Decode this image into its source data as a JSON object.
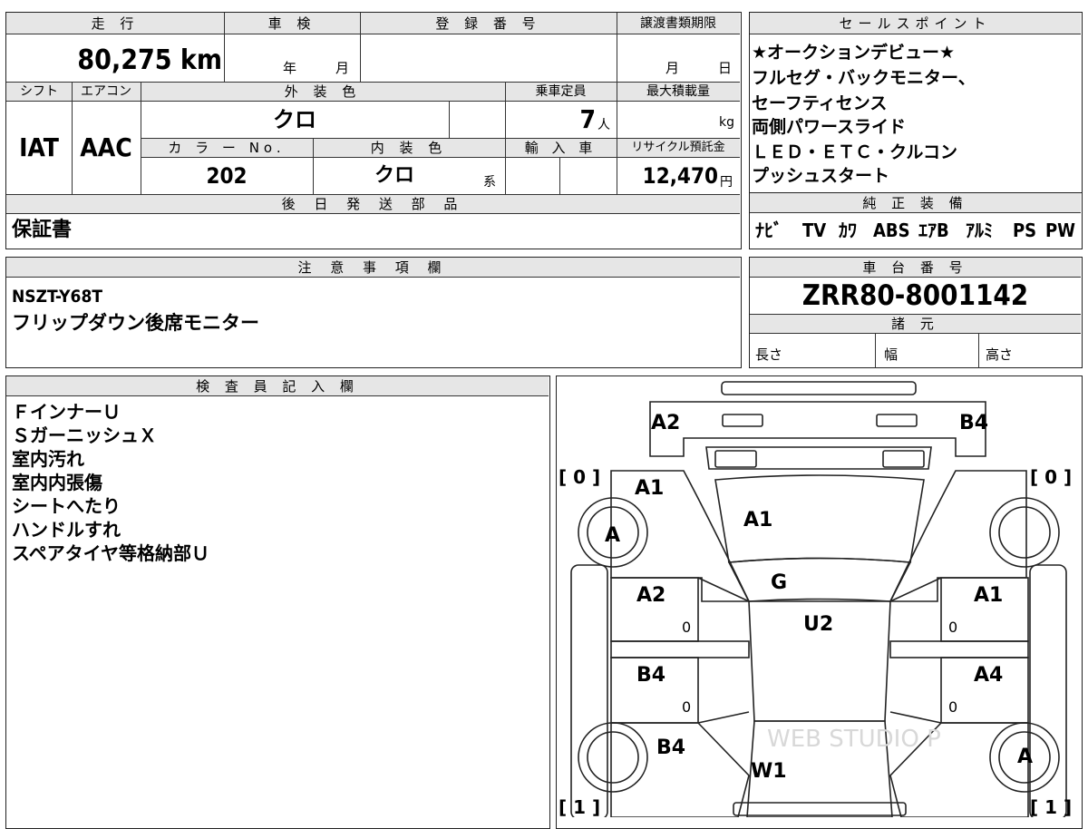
{
  "spec": {
    "mileage_header": "走 行",
    "mileage": "80,275 km",
    "shaken_header": "車 検",
    "shaken_year_unit": "年",
    "shaken_month_unit": "月",
    "reg_header": "登 録 番 号",
    "transfer_header": "譲渡書類期限",
    "transfer_month_unit": "月",
    "transfer_day_unit": "日",
    "shift_header": "シフト",
    "shift": "IAT",
    "ac_header": "エアコン",
    "ac": "AAC",
    "ext_color_header": "外 装 色",
    "ext_color": "クロ",
    "capacity_header": "乗車定員",
    "capacity": "7",
    "capacity_unit": "人",
    "maxload_header": "最大積載量",
    "maxload_unit": "kg",
    "color_no_header": "カ ラ ー No.",
    "color_no": "202",
    "int_color_header": "内 装 色",
    "int_color": "クロ",
    "int_color_suffix": "系",
    "import_header": "輸 入 車",
    "recycle_header": "リサイクル預託金",
    "recycle": "12,470",
    "recycle_unit": "円",
    "later_header": "後 日 発 送 部 品",
    "later_value": "保証書"
  },
  "sales": {
    "header": "セールスポイント",
    "lines": [
      "★オークションデビュー★",
      "フルセグ・バックモニター、",
      "セーフティセンス",
      "両側パワースライド",
      "ＬＥＤ・ＥＴＣ・クルコン",
      "プッシュスタート"
    ]
  },
  "equipment": {
    "header": "純 正 装 備",
    "items": [
      "ﾅﾋﾞ",
      "TV",
      "ｶﾜ",
      "ABS",
      "ｴｱB",
      "ｱﾙﾐ",
      "PS",
      "PW"
    ]
  },
  "notes": {
    "header": "注 意 事 項 欄",
    "line1": "NSZT-Y68T",
    "line2": "フリップダウン後席モニター"
  },
  "chassis": {
    "header": "車 台 番 号",
    "number": "ZRR80-8001142",
    "dims_header": "諸 元",
    "length": "長さ",
    "width": "幅",
    "height": "高さ"
  },
  "inspector": {
    "header": "検 査 員 記 入 欄",
    "lines": [
      "ＦインナーＵ",
      "ＳガーニッシュＸ",
      "室内汚れ",
      "室内内張傷",
      "シートへたり",
      "ハンドルすれ",
      "スペアタイヤ等格納部Ｕ"
    ]
  },
  "diagram": {
    "front_left": "A2",
    "front_right": "B4",
    "bracket_tl": "[ 0 ]",
    "bracket_tr": "[ 0 ]",
    "bracket_bl": "[ 1 ]",
    "bracket_br": "[ 1 ]",
    "fender_left": "A1",
    "hood": "A1",
    "wheel_fl": "A",
    "windshield": "G",
    "roof": "U2",
    "door_fl": "A2",
    "door_fr": "A1",
    "door_rl": "B4",
    "door_rr": "A4",
    "zero_fl": "0",
    "zero_fr": "0",
    "zero_rl": "0",
    "zero_rr": "0",
    "quarter_left": "B4",
    "rear_glass": "W1",
    "wheel_rr": "A",
    "watermark": "WEB STUDIO P"
  }
}
